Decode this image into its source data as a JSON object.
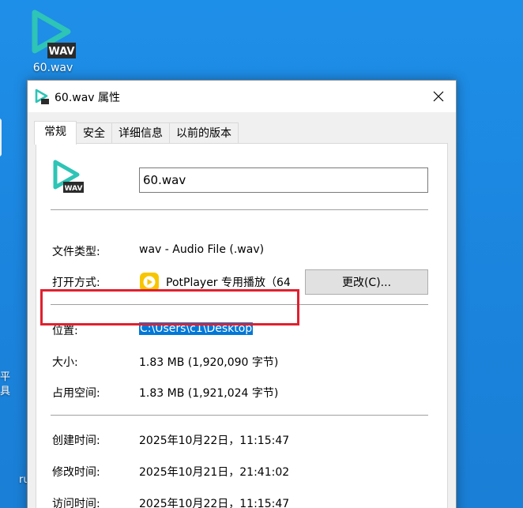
{
  "desktop": {
    "icon_label": "60.wav",
    "icon_badge": "WAV",
    "side_text_1": "平",
    "side_text_2": "具",
    "side_text_3": "ru",
    "background_color": "#1b86e0"
  },
  "dialog": {
    "title": "60.wav 属性",
    "close_icon": "close-icon",
    "tabs": [
      {
        "label": "常规",
        "active": true
      },
      {
        "label": "安全",
        "active": false
      },
      {
        "label": "详细信息",
        "active": false
      },
      {
        "label": "以前的版本",
        "active": false
      }
    ],
    "general": {
      "file_name": "60.wav",
      "file_type_label": "文件类型:",
      "file_type_value": "wav - Audio File (.wav)",
      "opens_with_label": "打开方式:",
      "opens_with_value": "PotPlayer 专用播放（64",
      "change_button": "更改(C)...",
      "location_label": "位置:",
      "location_value": "C:\\Users\\c1\\Desktop",
      "size_label": "大小:",
      "size_value": "1.83 MB (1,920,090 字节)",
      "size_on_disk_label": "占用空间:",
      "size_on_disk_value": "1.83 MB (1,921,024 字节)",
      "created_label": "创建时间:",
      "created_value": "2025年10月22日，11:15:47",
      "modified_label": "修改时间:",
      "modified_value": "2025年10月21日，21:41:02",
      "accessed_label": "访问时间:",
      "accessed_value": "2025年10月22日，11:15:47"
    },
    "colors": {
      "accent": "#0078d7",
      "highlight_box": "#e0202f",
      "icon_teal": "#2ec4b6",
      "app_icon_yellow": "#f7c600"
    }
  }
}
